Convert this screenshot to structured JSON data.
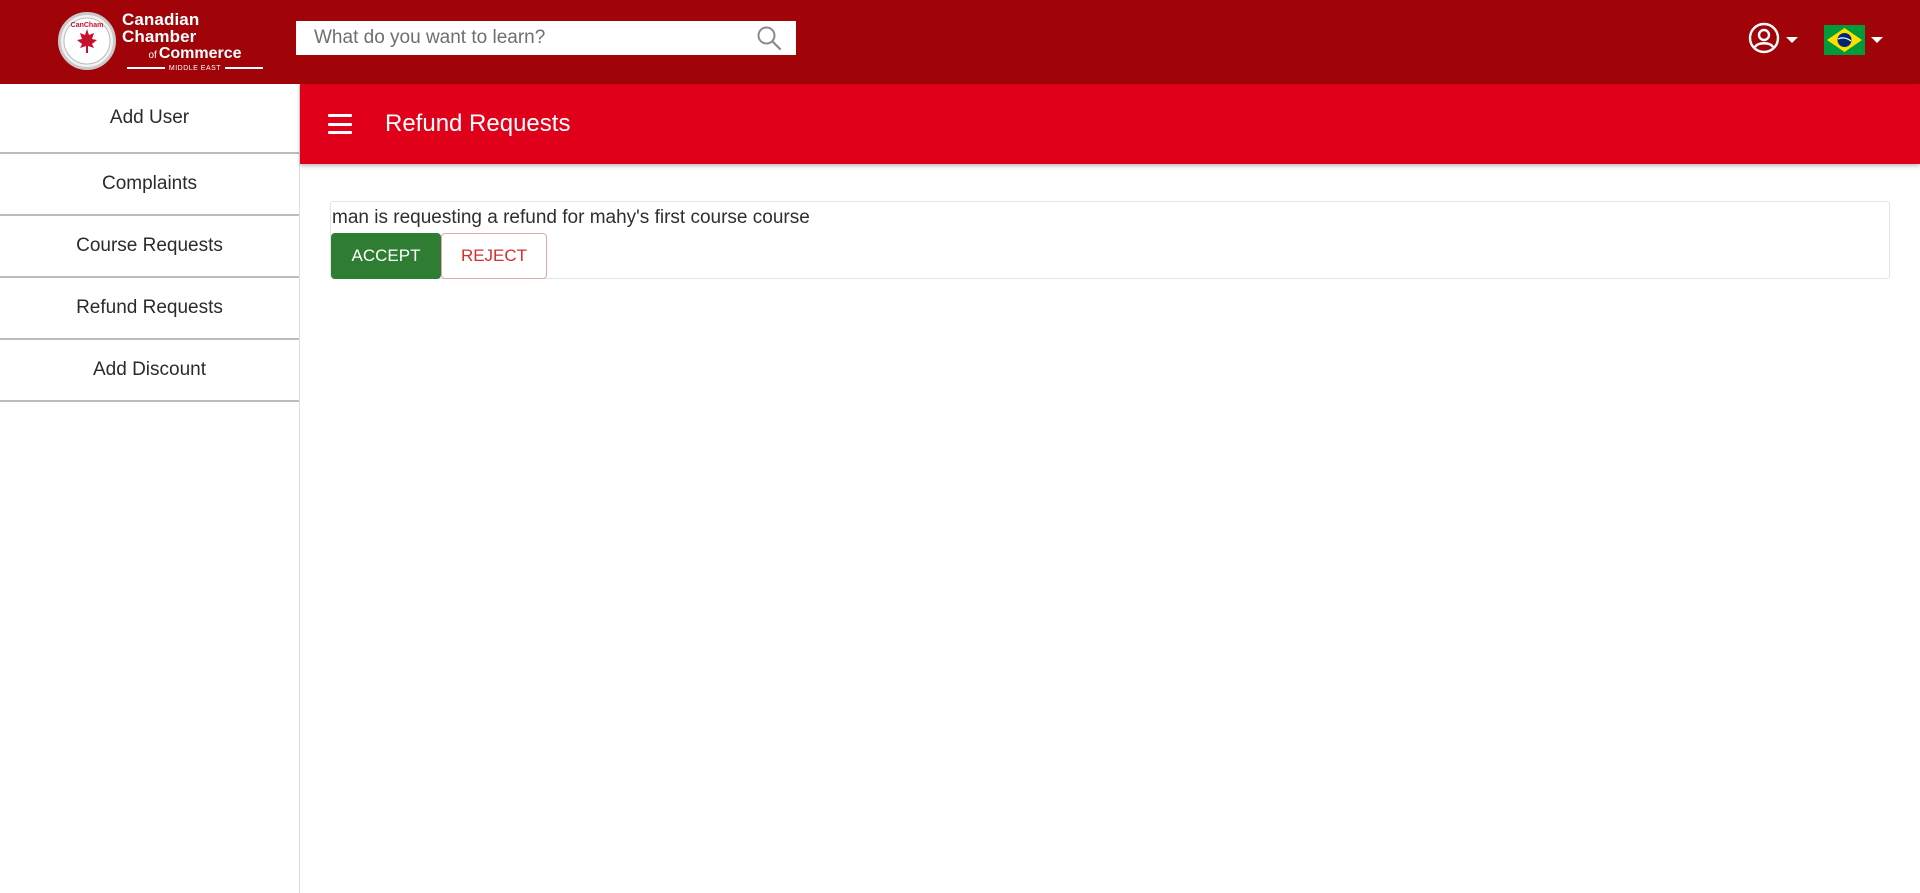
{
  "brand": {
    "line1": "Canadian Chamber",
    "line2_prefix": "of",
    "line2": "Commerce",
    "line3": "MIDDLE EAST",
    "seal_text": "CanCham"
  },
  "search": {
    "placeholder": "What do you want to learn?",
    "value": ""
  },
  "header": {
    "user_icon": "account-circle-icon",
    "language_flag": "brazil-flag-icon"
  },
  "sidebar": {
    "items": [
      {
        "label": "Add User"
      },
      {
        "label": "Complaints"
      },
      {
        "label": "Course Requests"
      },
      {
        "label": "Refund Requests"
      },
      {
        "label": "Add Discount"
      }
    ]
  },
  "main": {
    "title": "Refund Requests",
    "requests": [
      {
        "text": "man is requesting a refund for mahy's first course course",
        "accept_label": "ACCEPT",
        "reject_label": "REJECT"
      }
    ]
  },
  "colors": {
    "topbar": "#a00308",
    "header": "#e1001a",
    "accept": "#2e7d32",
    "reject": "#d32f2f"
  }
}
